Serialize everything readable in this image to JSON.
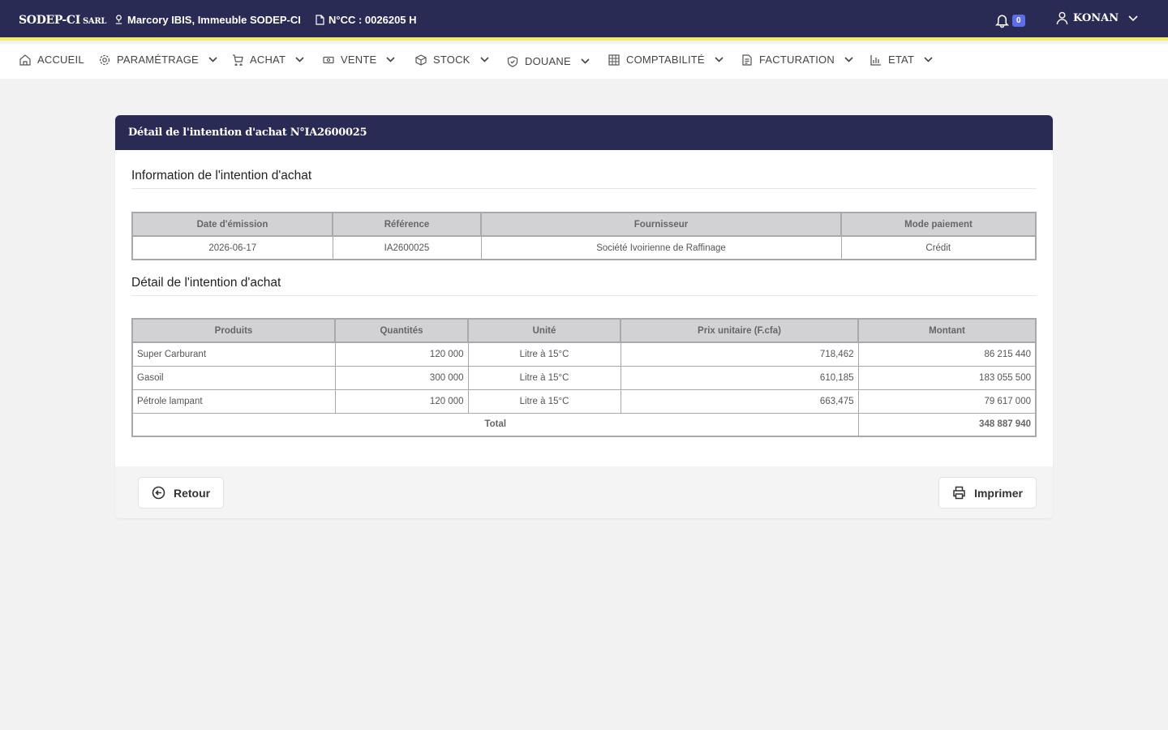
{
  "topbar": {
    "brand": "SODEP-CI",
    "brand_sub": "SARL",
    "address": "Marcory IBIS, Immeuble SODEP-CI",
    "ncc": "N°CC : 0026205 H",
    "notifications_count": "0",
    "user_name": "KONAN"
  },
  "nav": {
    "items": [
      {
        "label": "ACCUEIL",
        "icon": "home-icon"
      },
      {
        "label": "PARAMÉTRAGE",
        "icon": "gear-icon"
      },
      {
        "label": "ACHAT",
        "icon": "cart-icon"
      },
      {
        "label": "VENTE",
        "icon": "money-icon"
      },
      {
        "label": "STOCK",
        "icon": "box-icon"
      },
      {
        "label": "DOUANE",
        "icon": "shield-icon"
      },
      {
        "label": "COMPTABILITÉ",
        "icon": "grid-icon"
      },
      {
        "label": "FACTURATION",
        "icon": "invoice-icon"
      },
      {
        "label": "ETAT",
        "icon": "chart-icon"
      }
    ]
  },
  "card": {
    "title": "Détail de l'intention d'achat N°IA2600025",
    "info_section_title": "Information de l'intention d'achat",
    "info_table": {
      "headers": [
        "Date d'émission",
        "Référence",
        "Fournisseur",
        "Mode paiement"
      ],
      "row": [
        "2026-06-17",
        "IA2600025",
        "Société Ivoirienne de Raffinage",
        "Crédit"
      ]
    },
    "detail_section_title": "Détail de l'intention d'achat",
    "detail_table": {
      "headers": [
        "Produits",
        "Quantités",
        "Unité",
        "Prix unitaire (F.cfa)",
        "Montant"
      ],
      "rows": [
        [
          "Super Carburant",
          "120 000",
          "Litre à 15°C",
          "718,462",
          "86 215 440"
        ],
        [
          "Gasoil",
          "300 000",
          "Litre à 15°C",
          "610,185",
          "183 055 500"
        ],
        [
          "Pétrole lampant",
          "120 000",
          "Litre à 15°C",
          "663,475",
          "79 617 000"
        ]
      ],
      "total_label": "Total",
      "total_value": "348 887 940"
    },
    "buttons": {
      "back": "Retour",
      "print": "Imprimer"
    }
  },
  "colors": {
    "header_bg": "#2a2b55",
    "accent_line": "#f2ee6a",
    "badge": "#5b6ee8"
  }
}
